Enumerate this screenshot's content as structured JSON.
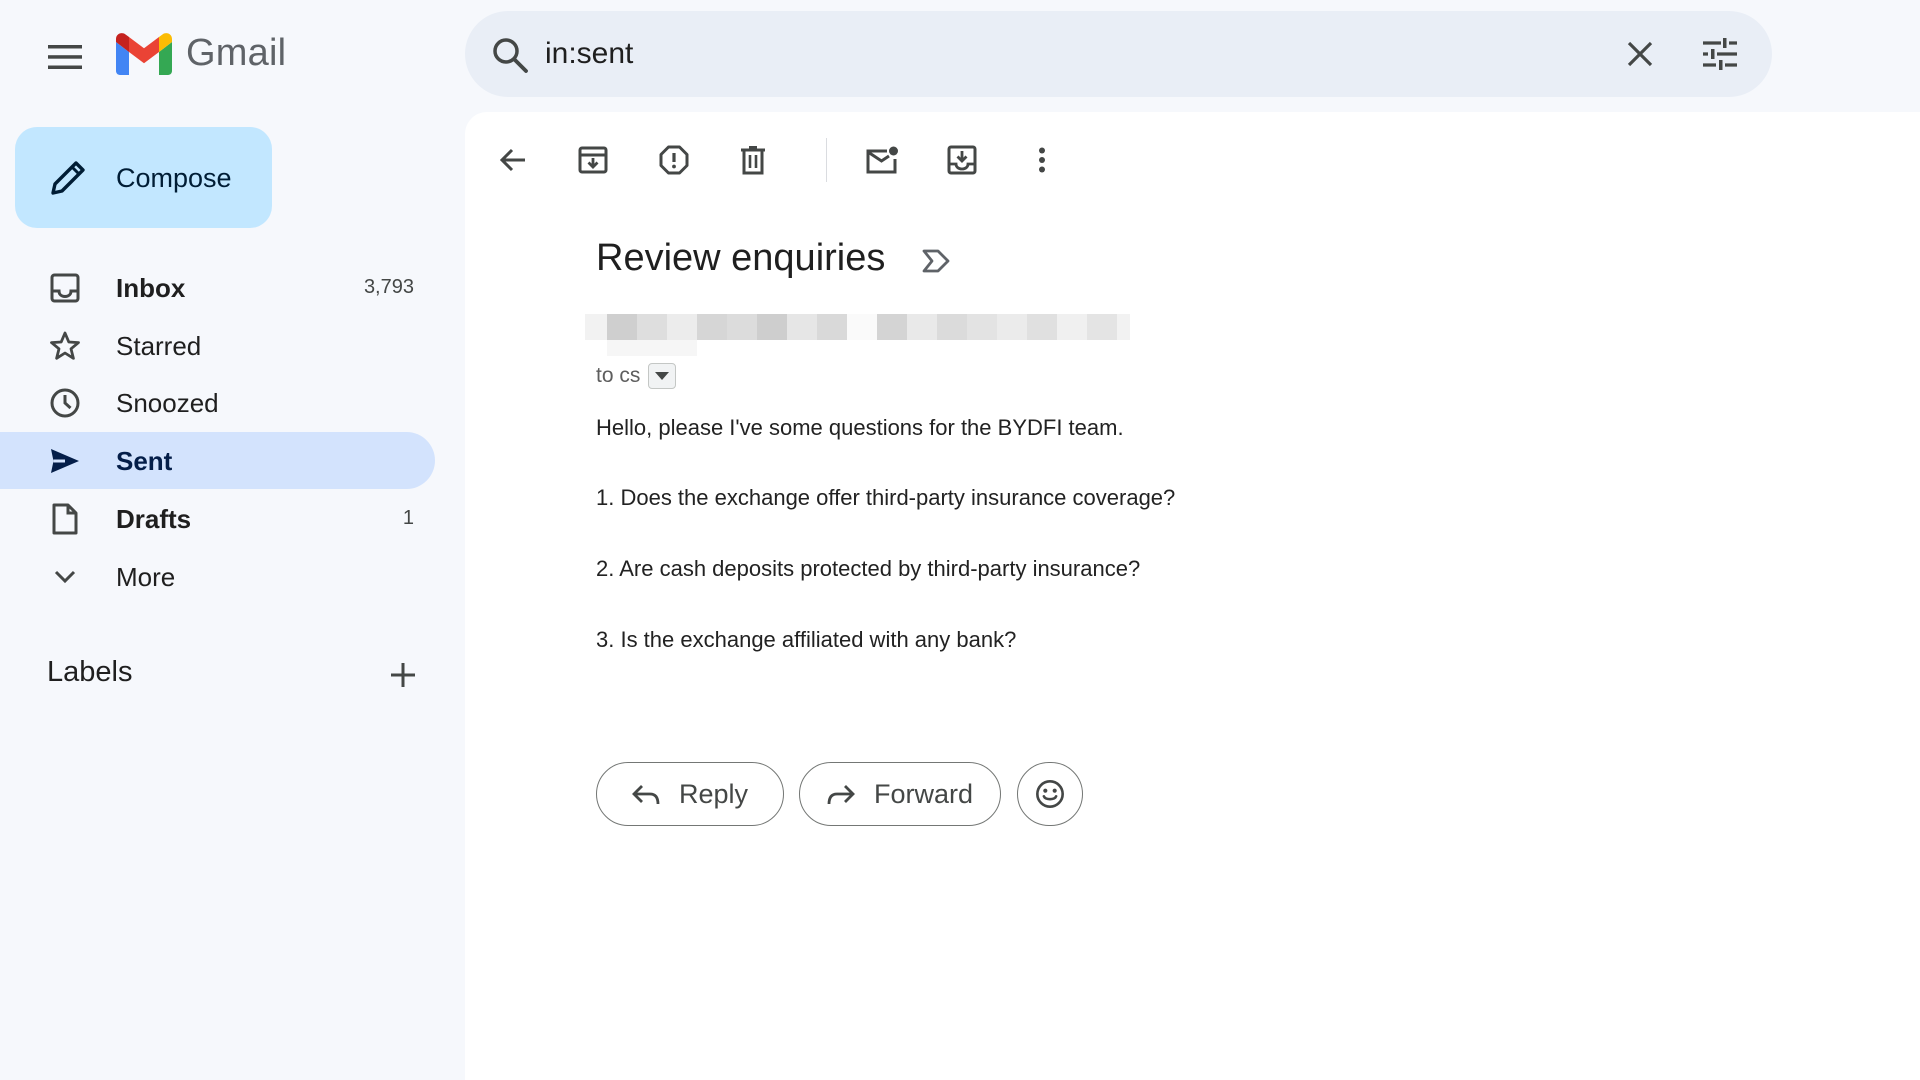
{
  "app": {
    "name": "Gmail",
    "colors": {
      "red": "#EA4335",
      "blue": "#4285F4",
      "green": "#34A853",
      "yellow": "#FBBC04",
      "accent": "#c2e7ff",
      "active_nav": "#d3e3fd"
    }
  },
  "search": {
    "value": "in:sent"
  },
  "compose": {
    "label": "Compose"
  },
  "sidebar": {
    "items": [
      {
        "label": "Inbox",
        "count": "3,793",
        "icon": "inbox-icon",
        "bold": true
      },
      {
        "label": "Starred",
        "count": "",
        "icon": "star-icon"
      },
      {
        "label": "Snoozed",
        "count": "",
        "icon": "clock-icon"
      },
      {
        "label": "Sent",
        "count": "",
        "icon": "send-icon",
        "active": true
      },
      {
        "label": "Drafts",
        "count": "1",
        "icon": "draft-icon",
        "bold": true
      },
      {
        "label": "More",
        "count": "",
        "icon": "chevron-down-icon"
      }
    ],
    "labels_heading": "Labels"
  },
  "toolbar": {
    "icons": [
      "back-arrow-icon",
      "archive-icon",
      "report-spam-icon",
      "delete-icon",
      "mark-unread-icon",
      "move-to-icon",
      "more-vert-icon"
    ]
  },
  "message": {
    "subject": "Review enquiries",
    "to_text": "to cs",
    "body": [
      "Hello, please I've some questions for the BYDFI team.",
      "1. Does the exchange offer third-party insurance coverage?",
      "2. Are cash deposits protected by third-party insurance?",
      "3. Is the exchange affiliated with any bank?"
    ]
  },
  "actions": {
    "reply": "Reply",
    "forward": "Forward"
  }
}
